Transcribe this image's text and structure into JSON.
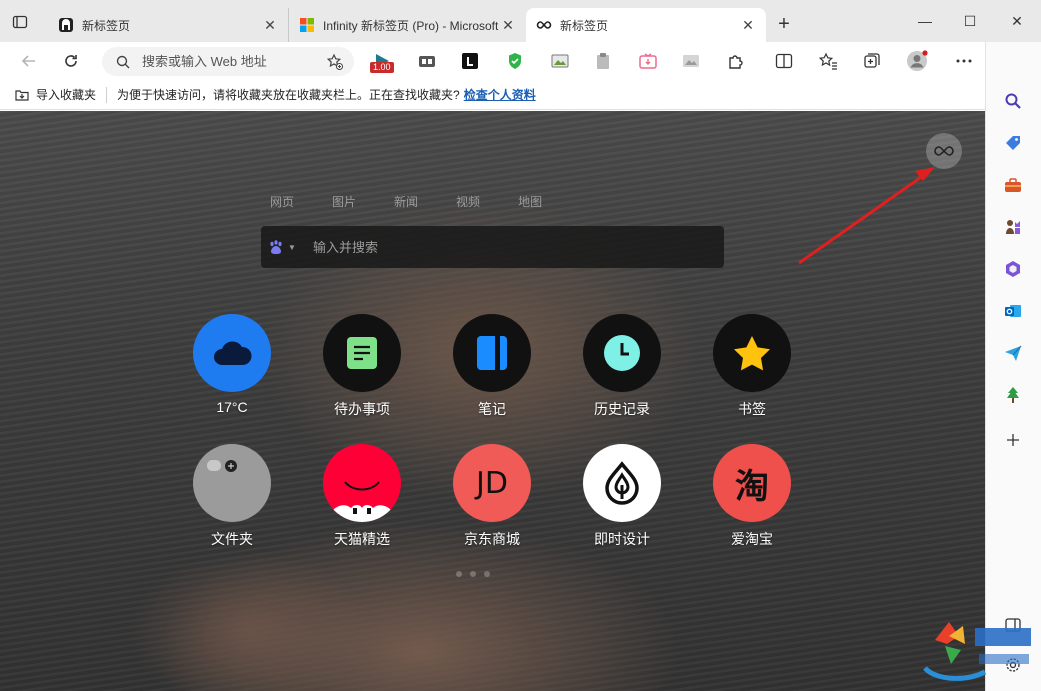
{
  "tabs": [
    {
      "title": "新标签页",
      "close": "✕"
    },
    {
      "title": "Infinity 新标签页 (Pro) - Microsoft",
      "close": "✕"
    },
    {
      "title": "新标签页",
      "close": "✕"
    }
  ],
  "new_tab": "+",
  "window": {
    "minimize": "—",
    "maximize": "☐",
    "close": "✕"
  },
  "toolbar": {
    "address_placeholder": "搜索或输入 Web 地址",
    "ext_badge": "1.00"
  },
  "bookmarks_bar": {
    "import_label": "导入收藏夹",
    "message": "为便于快速访问，请将收藏夹放在收藏夹栏上。正在查找收藏夹?",
    "link": "检查个人资料"
  },
  "newtab": {
    "engine_tabs": [
      "网页",
      "图片",
      "新闻",
      "视频",
      "地图"
    ],
    "search_placeholder": "输入并搜索",
    "apps": [
      {
        "label": "17°C",
        "icon": "cloud-icon",
        "bg": "#1e7cf0"
      },
      {
        "label": "待办事项",
        "icon": "todo-icon",
        "bg": "#111111"
      },
      {
        "label": "笔记",
        "icon": "note-icon",
        "bg": "#111111"
      },
      {
        "label": "历史记录",
        "icon": "clock-icon",
        "bg": "#111111"
      },
      {
        "label": "书签",
        "icon": "star-icon",
        "bg": "#111111"
      },
      {
        "label": "文件夹",
        "icon": "folder-icon",
        "bg": "#9b9b9b"
      },
      {
        "label": "天猫精选",
        "icon": "tmall-icon",
        "bg": "#ff0036"
      },
      {
        "label": "京东商城",
        "icon": "jd-icon",
        "bg": "#f05a57"
      },
      {
        "label": "即时设计",
        "icon": "jsdesign-icon",
        "bg": "#ffffff"
      },
      {
        "label": "爱淘宝",
        "icon": "taobao-icon",
        "bg": "#f0504c"
      }
    ],
    "jd_text": "JD",
    "taobao_text": "淘"
  },
  "colors": {
    "accent": "#1a5fb4",
    "arrow": "#e0201e"
  }
}
